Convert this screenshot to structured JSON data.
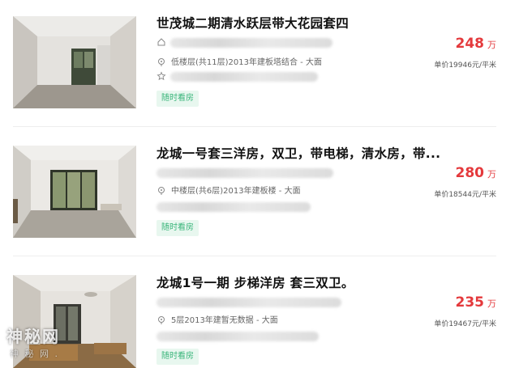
{
  "listings": [
    {
      "title": "世茂城二期清水跃层带大花园套四",
      "floor_info": "低楼层(共11层)2013年建板塔结合 - 大面",
      "tag": "随时看房",
      "price": "248",
      "price_unit": "万",
      "unit_price": "单价19946元/平米"
    },
    {
      "title": "龙城一号套三洋房，双卫，带电梯，清水房，带...",
      "floor_info": "中楼层(共6层)2013年建板楼 - 大面",
      "tag": "随时看房",
      "price": "280",
      "price_unit": "万",
      "unit_price": "单价18544元/平米"
    },
    {
      "title": "龙城1号一期 步梯洋房 套三双卫。",
      "floor_info": "5层2013年建暂无数据 - 大面",
      "tag": "随时看房",
      "price": "235",
      "price_unit": "万",
      "unit_price": "单价19467元/平米"
    }
  ],
  "watermark": {
    "main": "神秘网",
    "sub": "神 秘 网 ."
  },
  "icons": [
    "home-icon",
    "location-icon",
    "star-icon"
  ],
  "colors": {
    "price": "#e4393c",
    "tag_text": "#39b57a",
    "tag_bg": "#e8f7ef"
  }
}
